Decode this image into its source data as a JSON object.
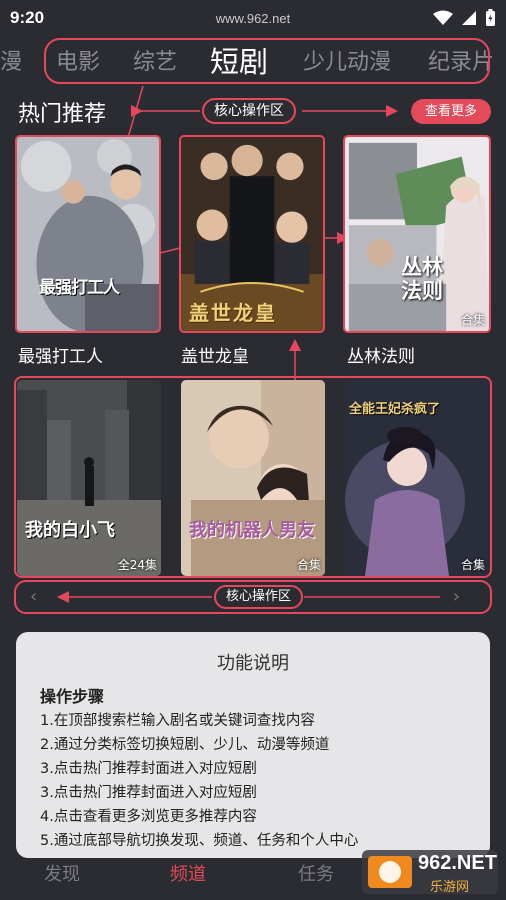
{
  "status_bar": {
    "time": "9:20",
    "url": "www.962.net"
  },
  "tabs": [
    "漫",
    "电影",
    "综艺",
    "短剧",
    "少儿动漫",
    "纪录片"
  ],
  "active_tab": "短剧",
  "section_title": "热门推荐",
  "annotation_label": "核心操作区",
  "more_button": "查看更多",
  "dramas": [
    {
      "title": "最强打工人",
      "poster_text": "最强打工人",
      "badge": ""
    },
    {
      "title": "盖世龙皇",
      "poster_text": "盖世龙皇",
      "badge": ""
    },
    {
      "title": "丛林法则",
      "poster_text": "丛林法则",
      "badge": "合集"
    },
    {
      "title": "",
      "poster_text": "我的白小飞",
      "badge": "全24集"
    },
    {
      "title": "",
      "poster_text": "我的机器人男友",
      "badge": "合集"
    },
    {
      "title": "",
      "poster_text": "全能王妃杀疯了",
      "badge": "合集"
    }
  ],
  "bottom_annotation_label": "核心操作区",
  "info_panel": {
    "title": "功能说明",
    "subtitle": "操作步骤",
    "steps": [
      "1.在顶部搜索栏输入剧名或关键词查找内容",
      "2.通过分类标签切换短剧、少儿、动漫等频道",
      "3.点击热门推荐封面进入对应短剧",
      "3.点击热门推荐封面进入对应短剧",
      "4.点击查看更多浏览更多推荐内容",
      "5.通过底部导航切换发现、频道、任务和个人中心"
    ]
  },
  "bottom_nav": [
    "发现",
    "频道",
    "任务"
  ],
  "watermark": {
    "brand": "962.NET",
    "sub": "乐游网"
  },
  "colors": {
    "accent": "#e34a5a",
    "annotation": "#e7475d",
    "background": "#2b2c31"
  }
}
